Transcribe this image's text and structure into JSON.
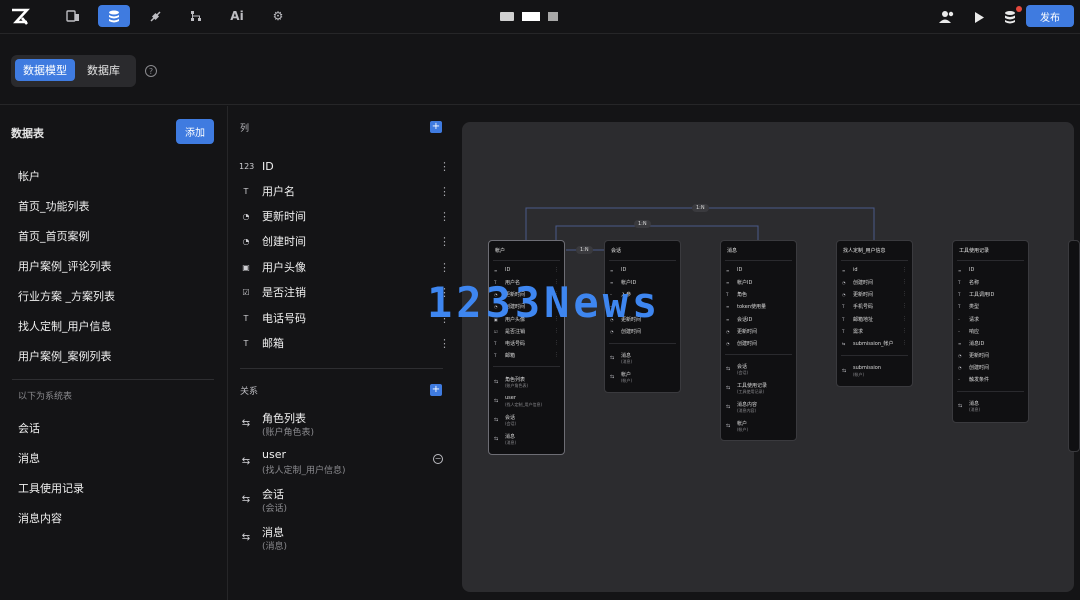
{
  "header": {
    "publish_label": "发布"
  },
  "subbar": {
    "tabs": [
      "数据模型",
      "数据库"
    ],
    "help": "?"
  },
  "left": {
    "title": "数据表",
    "add_label": "添加",
    "tables": [
      "帐户",
      "首页_功能列表",
      "首页_首页案例",
      "用户案例_评论列表",
      "行业方案 _方案列表",
      "找人定制_用户信息",
      "用户案例_案例列表"
    ],
    "system_label": "以下为系统表",
    "system_tables": [
      "会话",
      "消息",
      "工具使用记录",
      "消息内容"
    ]
  },
  "columns": {
    "title": "列",
    "items": [
      {
        "icon": "123",
        "name": "ID"
      },
      {
        "icon": "T",
        "name": "用户名"
      },
      {
        "icon": "◔",
        "name": "更新时间"
      },
      {
        "icon": "◔",
        "name": "创建时间"
      },
      {
        "icon": "▣",
        "name": "用户头像"
      },
      {
        "icon": "☑",
        "name": "是否注销"
      },
      {
        "icon": "T",
        "name": "电话号码"
      },
      {
        "icon": "T",
        "name": "邮箱"
      }
    ]
  },
  "relations": {
    "title": "关系",
    "items": [
      {
        "name": "角色列表",
        "sub": "(账户角色表)"
      },
      {
        "name": "user",
        "sub": "(找人定制_用户信息)"
      },
      {
        "name": "会话",
        "sub": "(会话)"
      },
      {
        "name": "消息",
        "sub": "(消息)"
      }
    ]
  },
  "diagram": {
    "edge_labels": [
      "1:N",
      "1:N",
      "1:N"
    ],
    "cards": [
      {
        "title": "帐户",
        "fields": [
          "ID",
          "用户名",
          "更新时间",
          "创建时间",
          "用户头像",
          "是否注销",
          "电话号码",
          "邮箱"
        ],
        "relations": [
          {
            "name": "角色列表",
            "sub": "(账户角色表)"
          },
          {
            "name": "user",
            "sub": "(找人定制_用户信息)"
          },
          {
            "name": "会话",
            "sub": "(会话)"
          },
          {
            "name": "消息",
            "sub": "(消息)"
          }
        ]
      },
      {
        "title": "会话",
        "fields": [
          "ID",
          "帐户ID",
          "入参",
          "",
          "更新时间",
          "创建时间"
        ],
        "relations": [
          {
            "name": "消息",
            "sub": "(消息)"
          },
          {
            "name": "帐户",
            "sub": "(帐户)"
          }
        ]
      },
      {
        "title": "消息",
        "fields": [
          "ID",
          "帐户ID",
          "角色",
          "token使用量",
          "会话ID",
          "更新时间",
          "创建时间"
        ],
        "relations": [
          {
            "name": "会话",
            "sub": "(会话)"
          },
          {
            "name": "工具使用记录",
            "sub": "(工具使用记录)"
          },
          {
            "name": "消息内容",
            "sub": "(消息内容)"
          },
          {
            "name": "帐户",
            "sub": "(帐户)"
          }
        ]
      },
      {
        "title": "找人定制_用户信息",
        "fields": [
          "id",
          "创建时间",
          "更新时间",
          "手机号码",
          "邮箱地址",
          "需求",
          "submission_帐户"
        ],
        "relations": [
          {
            "name": "submission",
            "sub": "(帐户)"
          }
        ]
      },
      {
        "title": "工具使用记录",
        "fields": [
          "ID",
          "名称",
          "工具调用ID",
          "类型",
          "请求",
          "响应",
          "消息ID",
          "更新时间",
          "创建时间",
          "触发条件"
        ],
        "relations": [
          {
            "name": "消息",
            "sub": "(消息)"
          }
        ]
      }
    ]
  },
  "watermark": "1233News"
}
